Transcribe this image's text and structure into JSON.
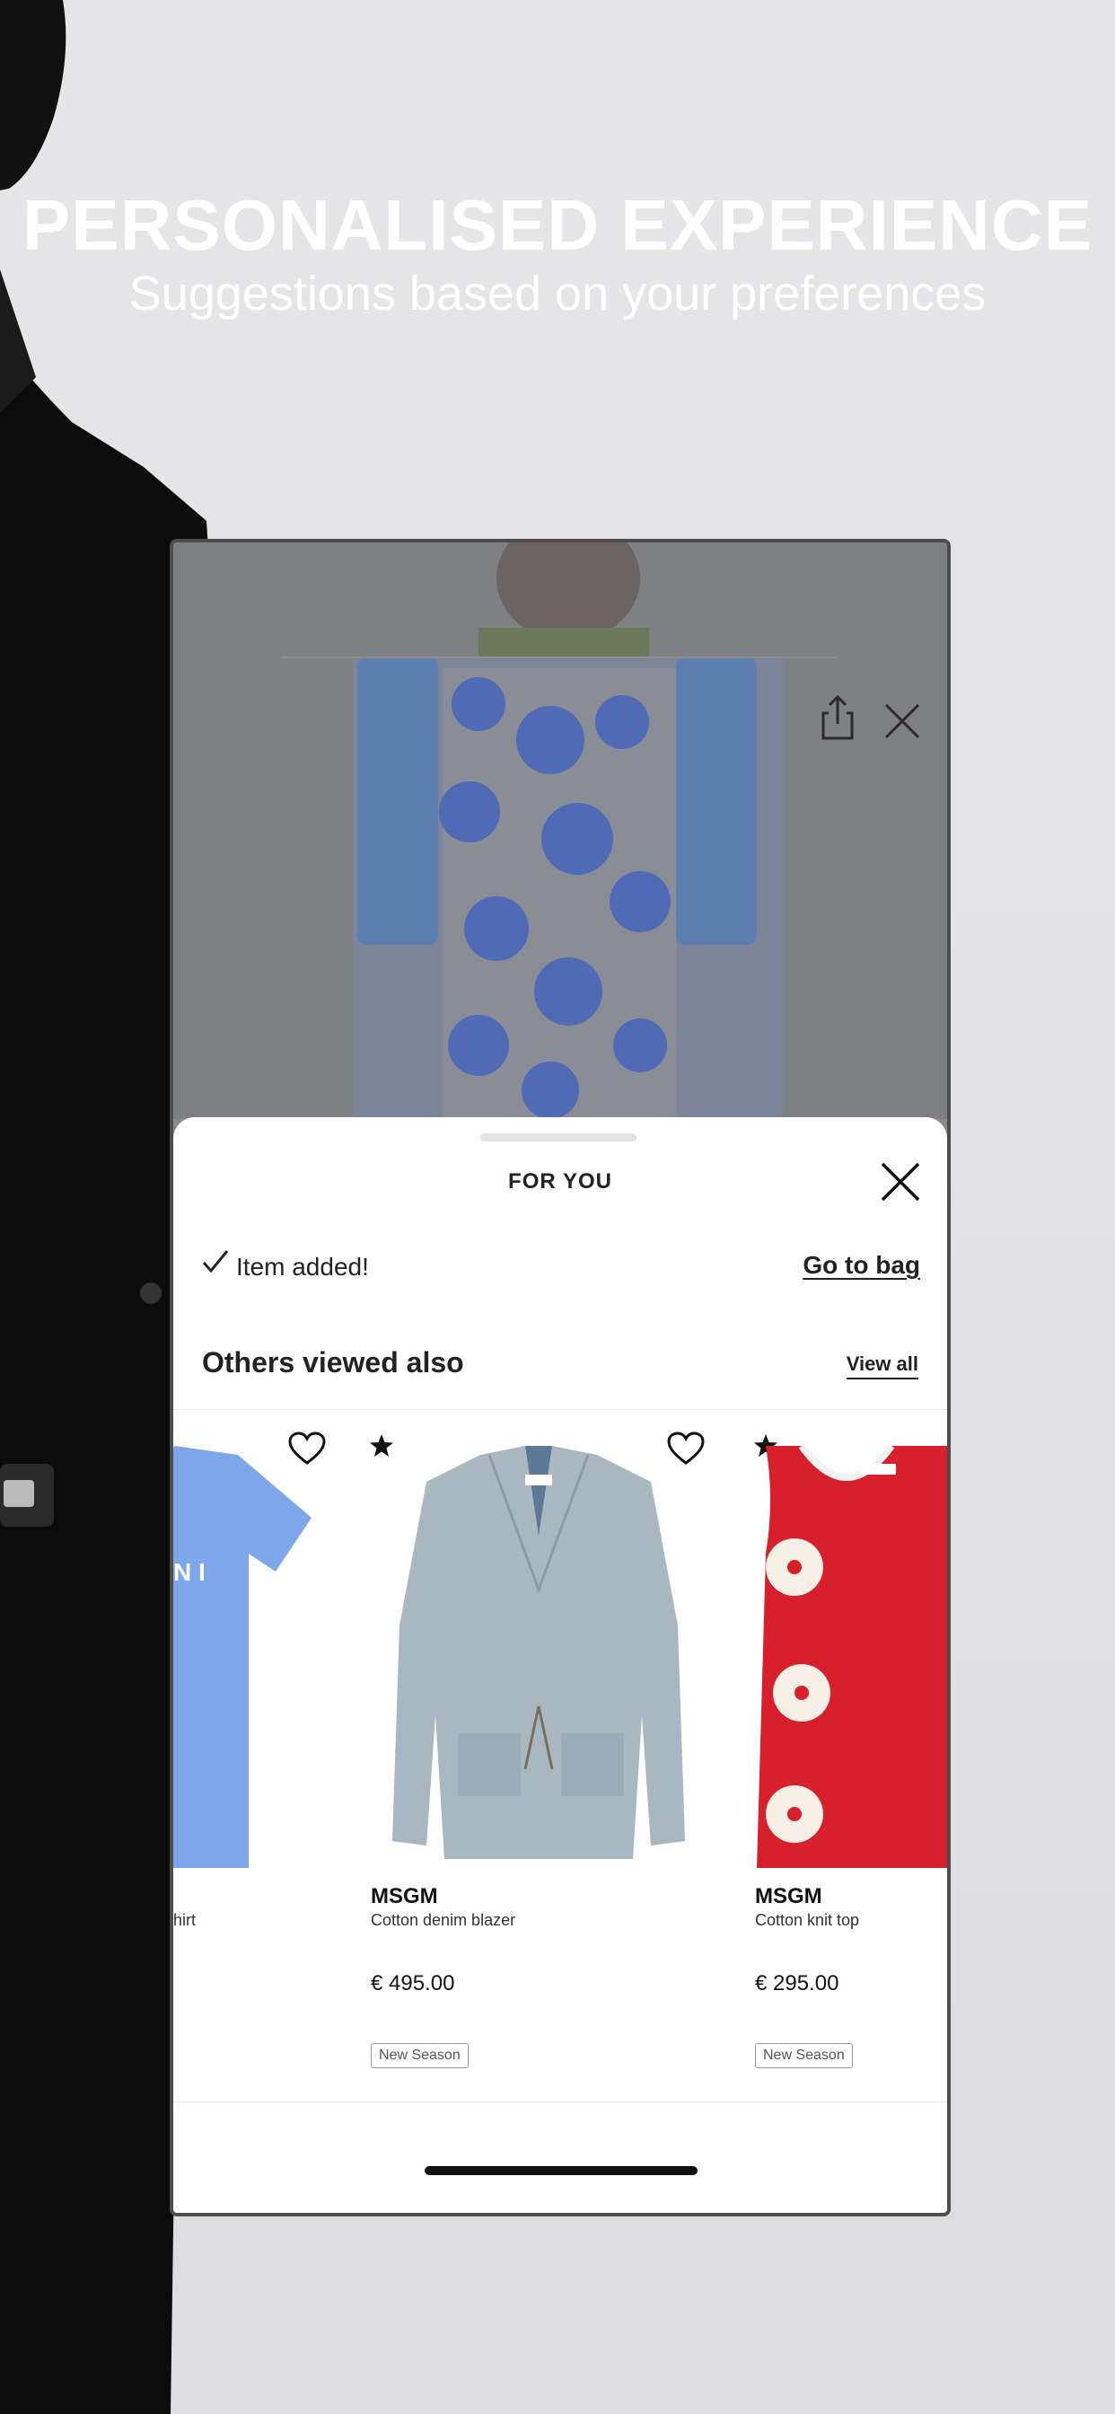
{
  "headline": "PERSONALISED EXPERIENCE",
  "subhead": "Suggestions based on your preferences",
  "sheet": {
    "title": "FOR YOU",
    "added_text": "Item added!",
    "go_to_bag": "Go to bag",
    "section_title": "Others viewed also",
    "view_all": "View all"
  },
  "products": [
    {
      "brand": "",
      "name": "hirt",
      "price": "",
      "badge": "",
      "image": "blue-tshirt"
    },
    {
      "brand": "MSGM",
      "name": "Cotton denim blazer",
      "price": "€ 495.00",
      "badge": "New Season",
      "image": "denim-blazer"
    },
    {
      "brand": "MSGM",
      "name": "Cotton knit top",
      "price": "€ 295.00",
      "badge": "New Season",
      "image": "red-knit-top"
    }
  ],
  "icons": {
    "share": "share-icon",
    "close": "close-icon",
    "check": "check-icon",
    "favorite": "heart-icon",
    "star": "star-icon"
  },
  "colors": {
    "overlay": "#7f8083",
    "sheet": "#ffffff",
    "text": "#222222",
    "tshirt": "#7ea6ea",
    "denim": "#a9b8c0",
    "knit_red": "#d81f2c"
  }
}
